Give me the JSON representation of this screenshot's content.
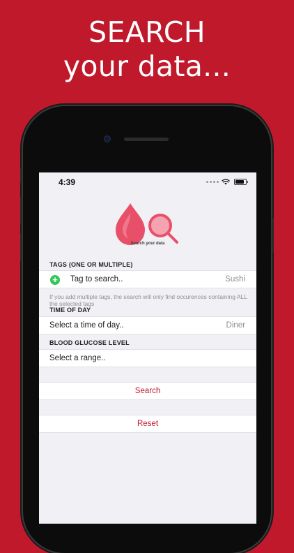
{
  "promo": {
    "line1": "SEARCH",
    "line2": "your data..."
  },
  "status_bar": {
    "time": "4:39"
  },
  "logo": {
    "caption": "Search your data",
    "accent_color": "#e8506a"
  },
  "tags_section": {
    "header": "TAGS (ONE OR MULTIPLE)",
    "field_label": "Tag to search..",
    "field_value": "Sushi",
    "footnote": "If you add multiple tags, the search will only find occurences containing ALL the selected tags"
  },
  "time_section": {
    "header": "TIME OF DAY",
    "field_label": "Select a time of day..",
    "field_value": "Diner"
  },
  "glucose_section": {
    "header": "BLOOD GLUCOSE LEVEL",
    "field_label": "Select a range.."
  },
  "actions": {
    "search_label": "Search",
    "reset_label": "Reset"
  },
  "colors": {
    "background": "#c0192c",
    "accent": "#c0192c",
    "add_button": "#34c759"
  }
}
